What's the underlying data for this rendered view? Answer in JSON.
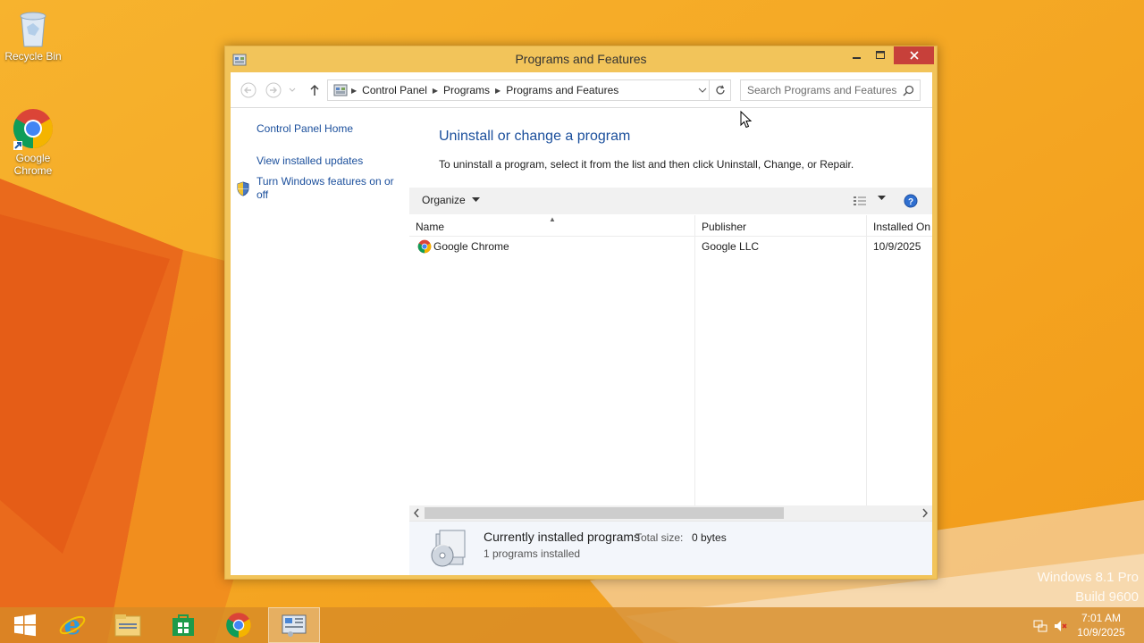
{
  "desktop": {
    "icons": [
      {
        "label": "Recycle Bin",
        "icon": "recycle-bin-icon"
      },
      {
        "label": "Google Chrome",
        "icon": "chrome-icon"
      }
    ],
    "watermark_line1": "Windows 8.1 Pro",
    "watermark_line2": "Build 9600"
  },
  "window": {
    "title": "Programs and Features",
    "icon": "control-panel-icon",
    "controls": {
      "minimize": "minimize-icon",
      "maximize": "maximize-icon",
      "close": "close-icon"
    }
  },
  "address": {
    "crumbs": [
      "Control Panel",
      "Programs",
      "Programs and Features"
    ],
    "search_placeholder": "Search Programs and Features"
  },
  "left_pane": {
    "home": "Control Panel Home",
    "updates": "View installed updates",
    "features": "Turn Windows features on or off"
  },
  "main": {
    "title": "Uninstall or change a program",
    "description": "To uninstall a program, select it from the list and then click Uninstall, Change, or Repair.",
    "toolbar": {
      "organize": "Organize"
    },
    "columns": [
      "Name",
      "Publisher",
      "Installed On"
    ],
    "rows": [
      {
        "name": "Google Chrome",
        "publisher": "Google LLC",
        "installed_on": "10/9/2025",
        "icon": "chrome-icon"
      }
    ]
  },
  "details": {
    "title": "Currently installed programs",
    "size_label": "Total size:",
    "size_value": "0 bytes",
    "count": "1 programs installed"
  },
  "taskbar": {
    "items": [
      "start-icon",
      "internet-explorer-icon",
      "file-explorer-icon",
      "store-icon",
      "chrome-icon",
      "control-panel-icon"
    ],
    "time": "7:01 AM",
    "date": "10/9/2025"
  },
  "colors": {
    "accent_link": "#1b4f9c",
    "close_red": "#c7403a",
    "wallpaper": "#f5a623"
  }
}
